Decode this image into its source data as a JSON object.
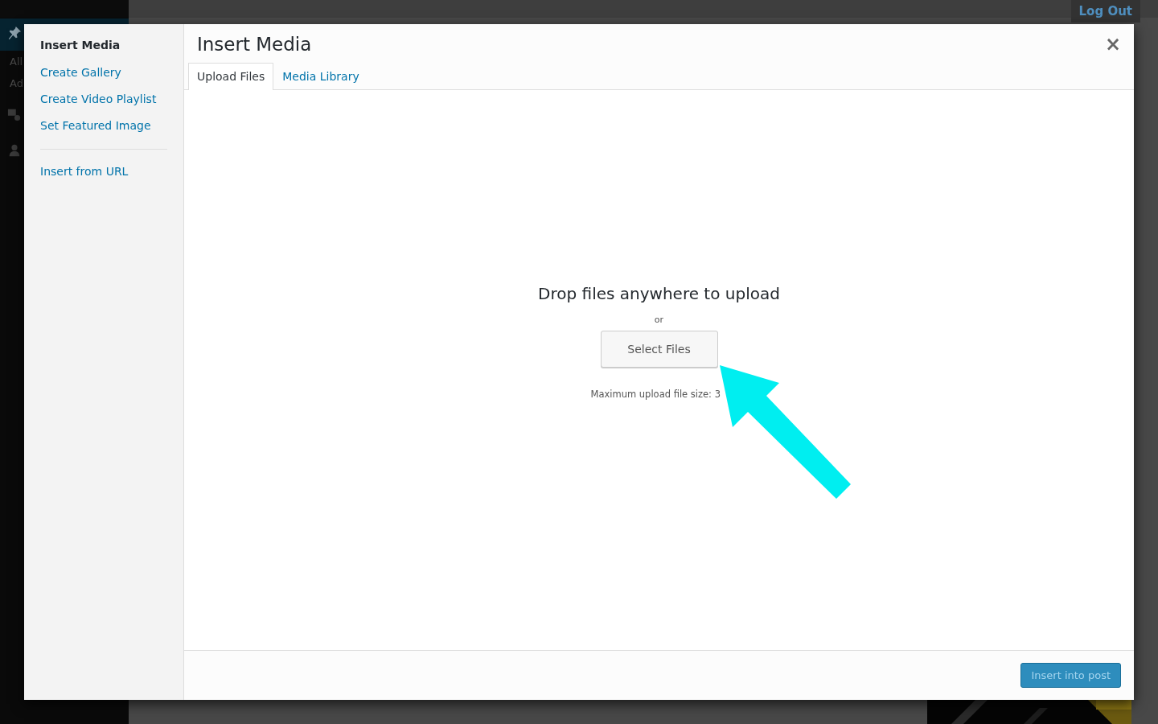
{
  "admin_bar": {
    "logout": "Log Out"
  },
  "admin_menu": {
    "items": [
      "All",
      "Ad"
    ]
  },
  "modal": {
    "close": "×",
    "menu": {
      "title": "Insert Media",
      "items": [
        {
          "label": "Create Gallery"
        },
        {
          "label": "Create Video Playlist"
        },
        {
          "label": "Set Featured Image"
        }
      ],
      "extra": [
        {
          "label": "Insert from URL"
        }
      ]
    },
    "title": "Insert Media",
    "tabs": [
      {
        "label": "Upload Files",
        "selected": true
      },
      {
        "label": "Media Library",
        "selected": false
      }
    ],
    "uploader": {
      "heading": "Drop files anywhere to upload",
      "or": "or",
      "button": "Select Files",
      "max_size": "Maximum upload file size: 3"
    },
    "footer": {
      "button": "Insert into post"
    }
  }
}
